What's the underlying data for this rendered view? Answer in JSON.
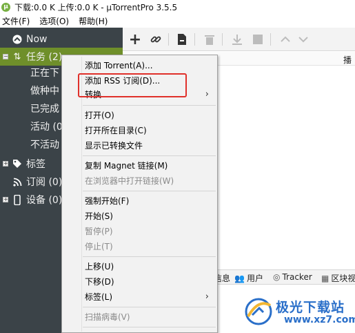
{
  "window": {
    "title": "下载:0.0 K 上传:0.0 K - µTorrentPro 3.5.5"
  },
  "menubar": {
    "items": [
      "文件(F)",
      "选项(O)",
      "帮助(H)"
    ]
  },
  "sidebar": {
    "now": "Now",
    "tasks": "任务 (2)",
    "downloading": "正在下",
    "seeding": "做种中",
    "completed": "已完成",
    "active": "活动 (0",
    "inactive": "不活动",
    "labels": "标签",
    "feeds": "订阅 (0)",
    "devices": "设备 (0)"
  },
  "list": {
    "col_play": "播"
  },
  "bottom_tabs": {
    "info": "信息",
    "peers": "用户",
    "trackers": "Tracker",
    "pieces": "区块视"
  },
  "context_menu": {
    "add_torrent": "添加 Torrent(A)...",
    "add_rss": "添加 RSS 订阅(D)...",
    "convert": "转换...",
    "open": "打开(O)",
    "open_folder": "打开所在目录(C)",
    "show_converted": "显示已转换文件",
    "copy_magnet": "复制 Magnet 链接(M)",
    "open_in_browser": "在浏览器中打开链接(W)",
    "force_start": "强制开始(F)",
    "start": "开始(S)",
    "pause": "暂停(P)",
    "stop": "停止(T)",
    "move_up": "上移(U)",
    "move_down": "下移(D)",
    "label": "标签(L)",
    "scan_virus": "扫描病毒(V)"
  },
  "watermark": {
    "name": "极光下载站",
    "url": "www.xz7.com"
  },
  "colors": {
    "sidebar_bg": "#3b4348",
    "selected_bg": "#6f8f2a",
    "highlight": "#e0302a",
    "watermark": "#2a6fc9"
  }
}
